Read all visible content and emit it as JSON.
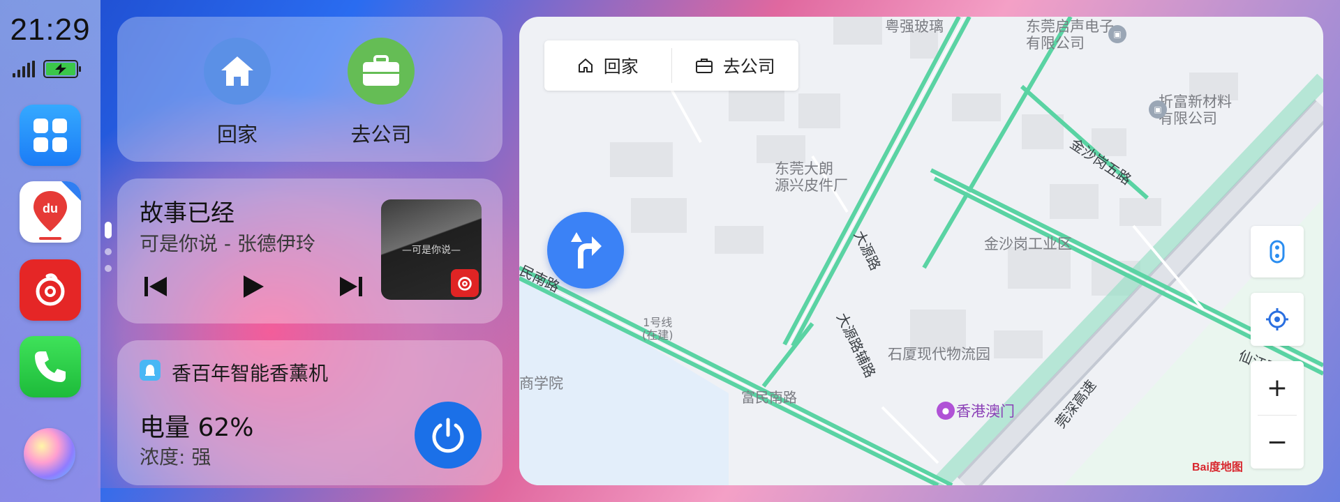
{
  "status": {
    "time": "21:29"
  },
  "shortcuts_card": {
    "home_label": "回家",
    "work_label": "去公司"
  },
  "music": {
    "title": "故事已经",
    "subtitle": "可是你说 - 张德伊玲",
    "album_text": "—可是你说—"
  },
  "device": {
    "name": "香百年智能香薰机",
    "battery_text": "电量 62%",
    "strength_text": "浓度: 强"
  },
  "map": {
    "shortcut_home": "回家",
    "shortcut_work": "去公司",
    "zoom_in": "+",
    "zoom_out": "−",
    "logo": "Bai度地图",
    "labels": {
      "l1": "粤强玻璃",
      "l2": "东莞启声电子\n有限公司",
      "l3": "折富新材料\n有限公司",
      "l4": "东莞大朗\n源兴皮件厂",
      "l5": "金沙岗工业区",
      "l6": "石厦现代物流园",
      "l7": "香港澳门",
      "l8": "商学院",
      "l9": "1号线\n(在建)"
    },
    "roads": {
      "r1": "金沙岗五路",
      "r2": "大源路",
      "r3": "大源路辅路",
      "r4": "富民南路",
      "r5": "民南路",
      "r6": "仙江路",
      "r7": "莞深高速"
    }
  },
  "colors": {
    "accent_blue": "#3b82f6",
    "work_green": "#65bd55",
    "home_blue": "#5b90e6",
    "music_red": "#e52626",
    "road_green": "#5ad3a3"
  }
}
